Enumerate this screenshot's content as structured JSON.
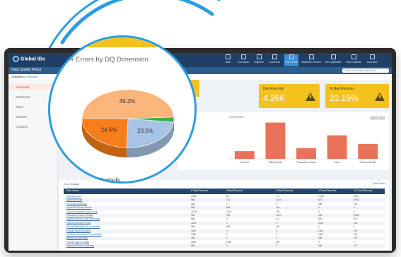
{
  "brand": {
    "name": "Global IDs"
  },
  "nav": {
    "items": [
      {
        "label": "Stat",
        "active": false
      },
      {
        "label": "Domains",
        "active": false
      },
      {
        "label": "Objects",
        "active": false
      },
      {
        "label": "Columns",
        "active": false
      },
      {
        "label": "DQ Rules",
        "active": true
      },
      {
        "label": "Business Rules",
        "active": false
      },
      {
        "label": "De-Duplicate",
        "active": false
      },
      {
        "label": "RACI Matrix",
        "active": false
      },
      {
        "label": "Account",
        "active": false
      }
    ]
  },
  "subbar": {
    "portal": "Data Quality Portal",
    "search_placeholder": "Search metadata repository"
  },
  "breadcrumb": {
    "root": "Database",
    "current": "Scorecard"
  },
  "sidebar": {
    "items": [
      {
        "label": "Scorecard",
        "active": true
      },
      {
        "label": "Dashboard",
        "active": false
      },
      {
        "label": "Rules",
        "active": false
      },
      {
        "label": "Monitors",
        "active": false
      },
      {
        "label": "Changes",
        "active": false
      }
    ]
  },
  "kpis": [
    {
      "label": "Bad Records",
      "value": "4.26K"
    },
    {
      "label": "% Bad Records",
      "value": "22.19%"
    }
  ],
  "chart_panel": {
    "title": "Connector",
    "link": "Show Chart"
  },
  "magnifier": {
    "title": "# Errors by DQ Dimension",
    "bottom_title": "Error Details"
  },
  "chart_data": [
    {
      "type": "pie",
      "title": "# Errors by DQ Dimension",
      "slices": [
        {
          "label": "49.2%",
          "value": 49.2,
          "color": "#fbb47a"
        },
        {
          "label": "24.5%",
          "value": 24.5,
          "color": "#f77d1a"
        },
        {
          "label": "23.5%",
          "value": 23.5,
          "color": "#a7c3e6"
        },
        {
          "value": 2.8,
          "color": "#3fae49"
        }
      ]
    },
    {
      "type": "bar",
      "categories": [
        "Customer",
        "Billing Details",
        "Transaction Header",
        "Sales",
        "Products Details"
      ],
      "values": [
        18,
        85,
        25,
        55,
        35
      ],
      "color": "#e8735a"
    }
  ],
  "table": {
    "title": "Error Details",
    "filter_link": "Clear Filter",
    "columns": [
      "Rule Name",
      "# Total Records",
      "# Bad Records",
      "% Bad Records",
      "# Good Records",
      "% Good Records"
    ],
    "rows": [
      [
        "Has last is null",
        "1,862",
        "82",
        "4.4",
        "1,780",
        "95.6"
      ],
      [
        "Duplicate Email",
        "986",
        "113",
        "11.46",
        "873",
        "88.54"
      ],
      [
        "Duplicate Addresses",
        "988",
        "0",
        "0",
        "988",
        "100"
      ],
      [
        "Duplicate Phone Number",
        "988",
        "988",
        "100",
        "0",
        "0"
      ],
      [
        "Account Activation Date is Null",
        "34218",
        "3418",
        "100",
        "0",
        "0"
      ],
      [
        "Transaction Date is Invalid",
        "986",
        "780",
        "76.11",
        "206",
        "23.89"
      ],
      [
        "Monthly Invoice is Not Generated",
        "986",
        "3",
        "0.3",
        "983",
        "99.7"
      ],
      [
        "Payment Amount is Null",
        "3206",
        "0",
        "0",
        "3206",
        "100"
      ],
      [
        "Product Information is Incomplete",
        "986",
        "986",
        "100",
        "0",
        "0"
      ],
      [
        "Product Name is Invalid",
        "1306",
        "0",
        "0",
        "1306",
        "100"
      ],
      [
        "Customer Information Not Updated",
        "1306",
        "0",
        "0",
        "1306",
        "100"
      ],
      [
        "Billing Info Unverified",
        "986",
        "0",
        "0",
        "986",
        "100"
      ],
      [
        "Product Type is Invalid",
        "1306",
        "1306",
        "100",
        "0",
        "0"
      ],
      [
        "Payment Method is Missing",
        "986",
        "0",
        "0",
        "986",
        "100"
      ]
    ]
  }
}
